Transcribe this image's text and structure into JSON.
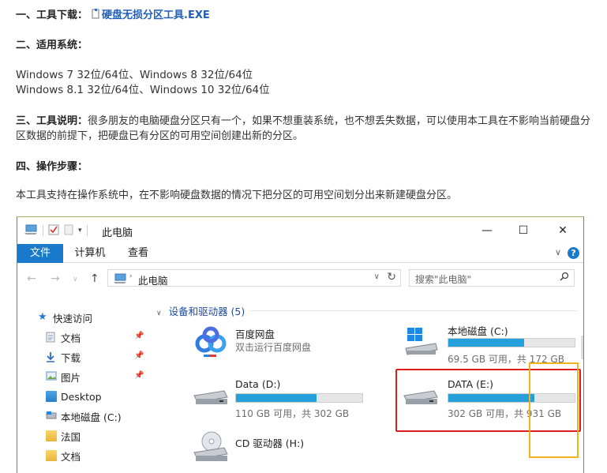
{
  "article": {
    "tool_download_label": "一、工具下载：",
    "tool_link_text": "硬盘无损分区工具.EXE",
    "systems_label": "二、适用系统：",
    "systems_line1": "Windows 7 32位/64位、Windows 8 32位/64位",
    "systems_line2": "Windows 8.1 32位/64位、Windows 10 32位/64位",
    "desc_label": "三、工具说明：",
    "desc_text": "很多朋友的电脑硬盘分区只有一个，如果不想重装系统，也不想丢失数据，可以使用本工具在不影响当前硬盘分区数据的前提下，把硬盘已有分区的可用空间创建出新的分区。",
    "steps_label": "四、操作步骤：",
    "intro_text": "本工具支持在操作系统中，在不影响硬盘数据的情况下把分区的可用空间划分出来新建硬盘分区。"
  },
  "explorer": {
    "title": "此电脑",
    "controls": {
      "minimize": "—",
      "maximize": "☐",
      "close": "✕"
    },
    "ribbon_tabs": [
      "文件",
      "计算机",
      "查看"
    ],
    "help": "?",
    "address": "此电脑",
    "search_placeholder": "搜索\"此电脑\"",
    "nav": {
      "quick_access": "快速访问",
      "items": [
        "文档",
        "下载",
        "图片",
        "Desktop",
        "本地磁盘 (C:)",
        "法国",
        "文档"
      ]
    },
    "group_header": "设备和驱动器 (5)",
    "drives": [
      {
        "name": "百度网盘",
        "sub": "双击运行百度网盘"
      },
      {
        "name": "本地磁盘 (C:)",
        "sub": "69.5 GB 可用，共 172 GB",
        "used_fraction": 0.6
      },
      {
        "name": "Data (D:)",
        "sub": "110 GB 可用，共 302 GB",
        "used_fraction": 0.64
      },
      {
        "name": "DATA (E:)",
        "sub": "302 GB 可用，共 931 GB",
        "used_fraction": 0.68
      },
      {
        "name": "CD 驱动器 (H:)"
      }
    ]
  },
  "colors": {
    "accent_blue": "#1979ca",
    "bar_fill": "#26a0da",
    "highlight_red": "#e21c1c",
    "highlight_yellow": "#f2b21b",
    "link": "#1f5fb8"
  }
}
